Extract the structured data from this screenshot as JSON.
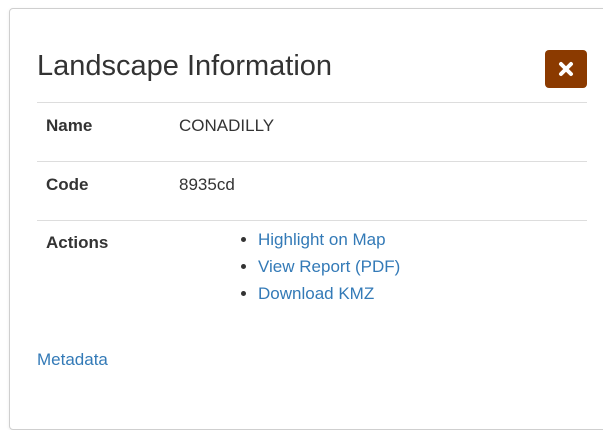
{
  "dialog": {
    "title": "Landscape Information",
    "close_icon": "close-icon",
    "close_color": "#8b3a00"
  },
  "table": {
    "rows": [
      {
        "label": "Name",
        "value": "CONADILLY"
      },
      {
        "label": "Code",
        "value": "8935cd"
      }
    ],
    "actions_label": "Actions",
    "actions": [
      {
        "label": "Highlight on Map"
      },
      {
        "label": "View Report (PDF)"
      },
      {
        "label": "Download KMZ"
      }
    ]
  },
  "footer": {
    "metadata_link": "Metadata"
  },
  "colors": {
    "link": "#337ab7",
    "text": "#333333",
    "divider": "#dddddd"
  }
}
